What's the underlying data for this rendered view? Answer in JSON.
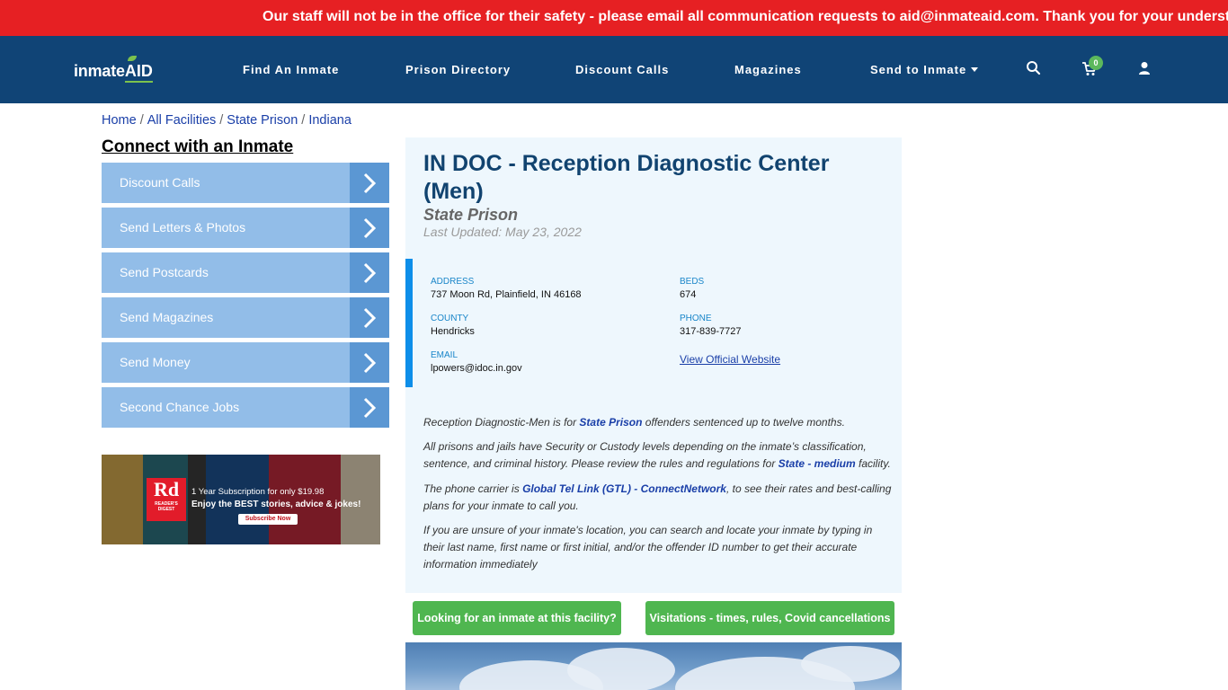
{
  "alert": {
    "text": "Our staff will not be in the office for their safety - please email all communication requests to aid@inmateaid.com. Thank you for your understanding."
  },
  "navbar": {
    "logo_main": "inmate",
    "logo_aid": "AID",
    "items": [
      {
        "label": "Find An Inmate"
      },
      {
        "label": "Prison Directory"
      },
      {
        "label": "Discount Calls"
      },
      {
        "label": "Magazines"
      },
      {
        "label": "Send to Inmate"
      }
    ],
    "cart_count": "0",
    "icons": [
      "search-icon",
      "cart-icon",
      "user-icon"
    ]
  },
  "breadcrumb": {
    "items": [
      "Home",
      "All Facilities",
      "State Prison",
      "Indiana"
    ],
    "separator": "/"
  },
  "sidebar": {
    "title": "Connect with an Inmate",
    "buttons": [
      {
        "label": "Discount Calls"
      },
      {
        "label": "Send Letters & Photos"
      },
      {
        "label": "Send Postcards"
      },
      {
        "label": "Send Magazines"
      },
      {
        "label": "Send Money"
      },
      {
        "label": "Second Chance Jobs"
      }
    ]
  },
  "ad": {
    "logo_big": "Rd",
    "logo_small": "READER'S DIGEST",
    "line1": "1 Year Subscription for only $19.98",
    "line2": "Enjoy the BEST stories, advice & jokes!",
    "cta": "Subscribe Now"
  },
  "facility": {
    "title": "IN DOC - Reception Diagnostic Center (Men)",
    "type": "State Prison",
    "updated": "Last Updated: May 23, 2022",
    "address_label": "ADDRESS",
    "address": "737 Moon Rd, Plainfield, IN 46168",
    "beds_label": "BEDS",
    "beds": "674",
    "county_label": "COUNTY",
    "county": "Hendricks",
    "phone_label": "PHONE",
    "phone": "317-839-7727",
    "email_label": "EMAIL",
    "email": "lpowers@idoc.in.gov",
    "website_link": "View Official Website"
  },
  "description": {
    "p1_pre": "Reception Diagnostic-Men is for ",
    "p1_link": "State Prison",
    "p1_post": " offenders sentenced up to twelve months.",
    "p2_pre": "All prisons and jails have Security or Custody levels depending on the inmate’s classification, sentence, and criminal history. Please review the rules and regulations for ",
    "p2_link": "State - medium",
    "p2_post": " facility.",
    "p3_pre": "The phone carrier is ",
    "p3_link": "Global Tel Link (GTL) - ConnectNetwork",
    "p3_post": ", to see their rates and best-calling plans for your inmate to call you.",
    "p4": "If you are unsure of your inmate's location, you can search and locate your inmate by typing in their last name, first name or first initial, and/or the offender ID number to get their accurate information immediately"
  },
  "actions": {
    "find_inmate": "Looking for an inmate at this facility?",
    "visitations": "Visitations - times, rules, Covid cancellations"
  },
  "colors": {
    "alert_red": "#e62023",
    "nav_blue": "#104476",
    "side_btn": "#92bde8",
    "side_btn_arrow": "#5b97d3",
    "card_bg": "#eef7fd",
    "accent_blue": "#0d8ee9",
    "green": "#4fb650"
  }
}
